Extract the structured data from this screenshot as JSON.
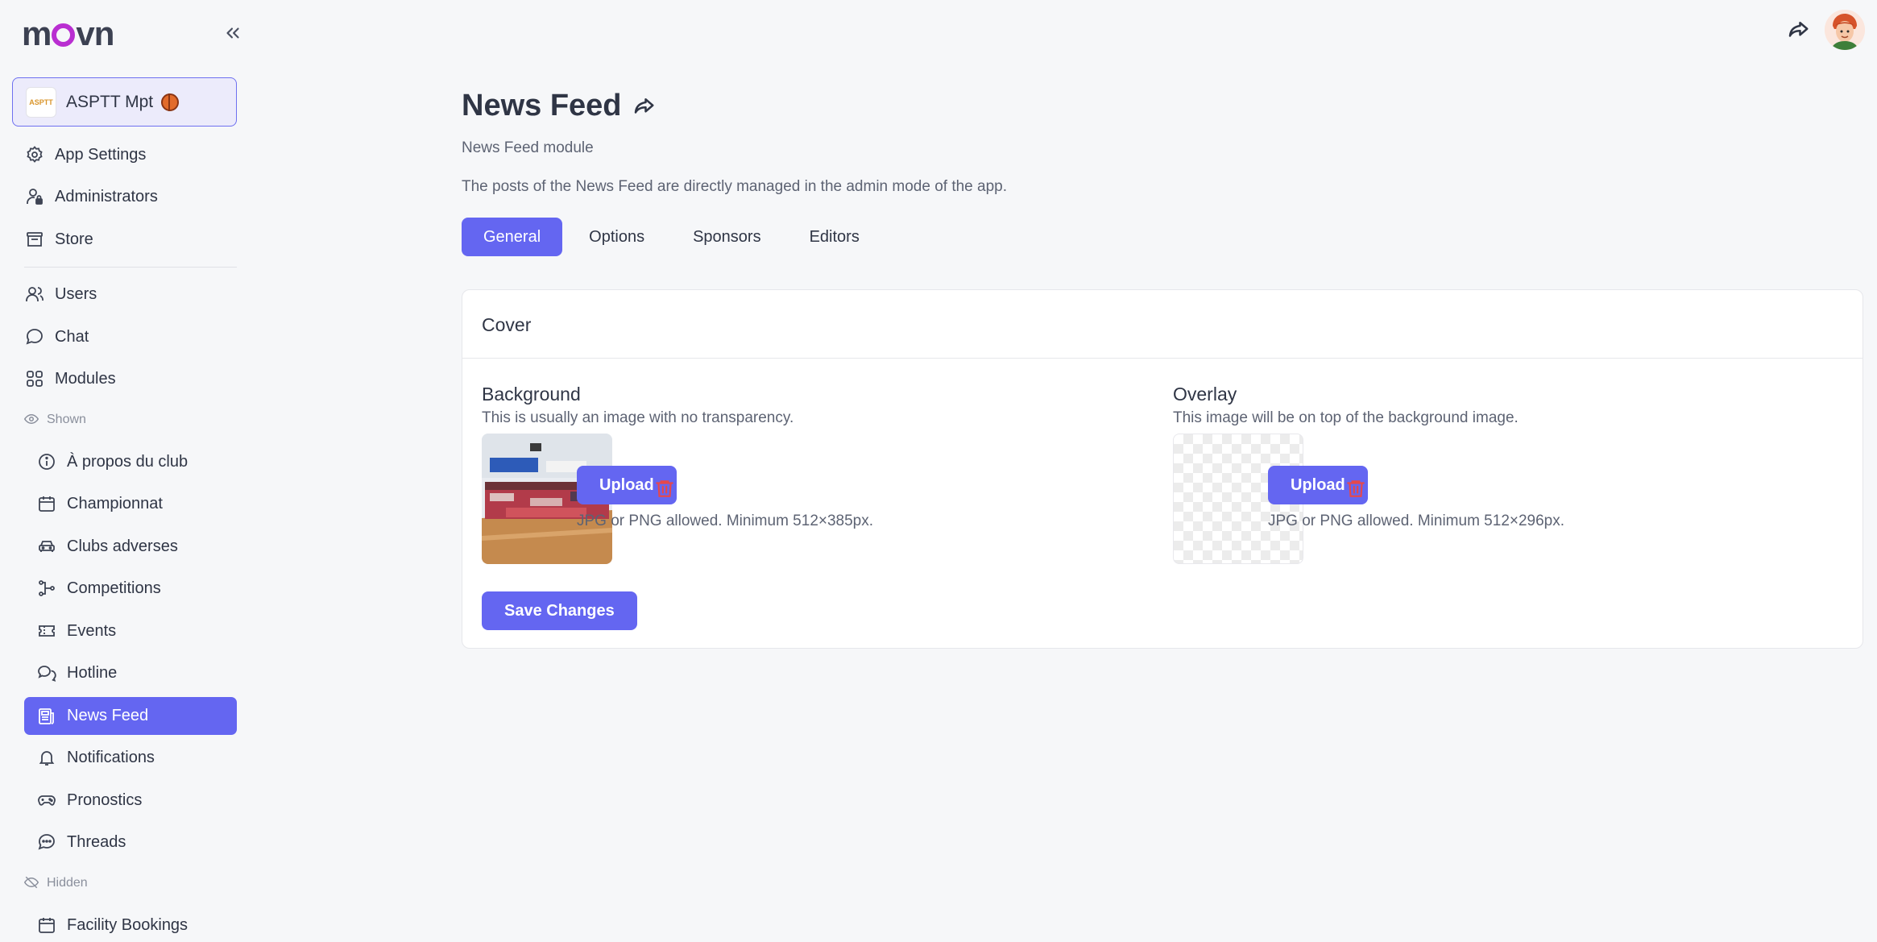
{
  "app": {
    "logo": "movn",
    "logo_parts": [
      "m",
      "vn"
    ]
  },
  "org": {
    "name": "ASPTT Mpt",
    "logo_text": "ASPTT"
  },
  "sidebar": {
    "top_items": [
      {
        "label": "App Settings",
        "icon": "gear-icon"
      },
      {
        "label": "Administrators",
        "icon": "user-lock-icon"
      },
      {
        "label": "Store",
        "icon": "store-icon"
      }
    ],
    "main_items": [
      {
        "label": "Users",
        "icon": "users-icon"
      },
      {
        "label": "Chat",
        "icon": "chat-bubble-icon"
      },
      {
        "label": "Modules",
        "icon": "grid-icon"
      }
    ],
    "shown_label": "Shown",
    "shown_items": [
      {
        "label": "À propos du club",
        "icon": "info-icon"
      },
      {
        "label": "Championnat",
        "icon": "calendar-icon"
      },
      {
        "label": "Clubs adverses",
        "icon": "car-icon"
      },
      {
        "label": "Competitions",
        "icon": "bracket-icon"
      },
      {
        "label": "Events",
        "icon": "ticket-icon"
      },
      {
        "label": "Hotline",
        "icon": "chats-icon"
      },
      {
        "label": "News Feed",
        "icon": "newspaper-icon",
        "active": true
      },
      {
        "label": "Notifications",
        "icon": "bell-icon"
      },
      {
        "label": "Pronostics",
        "icon": "gamepad-icon"
      },
      {
        "label": "Threads",
        "icon": "message-dots-icon"
      }
    ],
    "hidden_label": "Hidden",
    "hidden_items": [
      {
        "label": "Facility Bookings",
        "icon": "calendar-icon"
      }
    ]
  },
  "main": {
    "title": "News Feed",
    "subtitle": "News Feed module",
    "description": "The posts of the News Feed are directly managed in the admin mode of the app.",
    "tabs": [
      {
        "label": "General",
        "active": true
      },
      {
        "label": "Options"
      },
      {
        "label": "Sponsors"
      },
      {
        "label": "Editors"
      }
    ],
    "card": {
      "title": "Cover",
      "background": {
        "title": "Background",
        "hint": "This is usually an image with no transparency.",
        "upload_label": "Upload",
        "rule": "JPG or PNG allowed. Minimum 512×385px."
      },
      "overlay": {
        "title": "Overlay",
        "hint": "This image will be on top of the background image.",
        "upload_label": "Upload",
        "rule": "JPG or PNG allowed. Minimum 512×296px."
      },
      "save_label": "Save Changes"
    }
  },
  "colors": {
    "accent": "#6466f1",
    "danger": "#e5484d",
    "logo_o": "#b92ed1"
  }
}
